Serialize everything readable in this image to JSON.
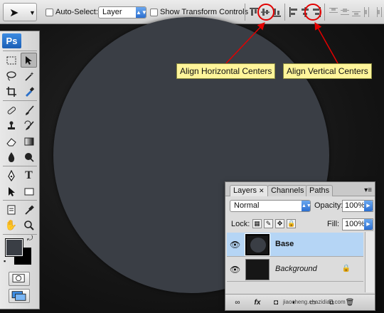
{
  "options_bar": {
    "auto_select_label": "Auto-Select:",
    "auto_select_target": "Layer",
    "show_transform_label": "Show Transform Controls"
  },
  "callouts": {
    "horizontal": "Align Horizontal Centers",
    "vertical": "Align Vertical Centers"
  },
  "toolbox": {
    "logo": "Ps"
  },
  "colors": {
    "canvas_circle": "#3a3e45",
    "foreground": "#3a3e45",
    "background": "#000000",
    "highlight": "#e30000",
    "callout_bg": "#fff59a",
    "selected_layer": "#b5d5f5"
  },
  "layers_panel": {
    "tabs": [
      "Layers",
      "Channels",
      "Paths"
    ],
    "blend_mode": "Normal",
    "opacity_label": "Opacity:",
    "opacity": "100%",
    "lock_label": "Lock:",
    "fill_label": "Fill:",
    "fill": "100%",
    "layers": [
      {
        "name": "Base",
        "selected": true
      },
      {
        "name": "Background",
        "selected": false,
        "locked": true
      }
    ]
  },
  "watermark": "jiaocheng.chazidian.com"
}
